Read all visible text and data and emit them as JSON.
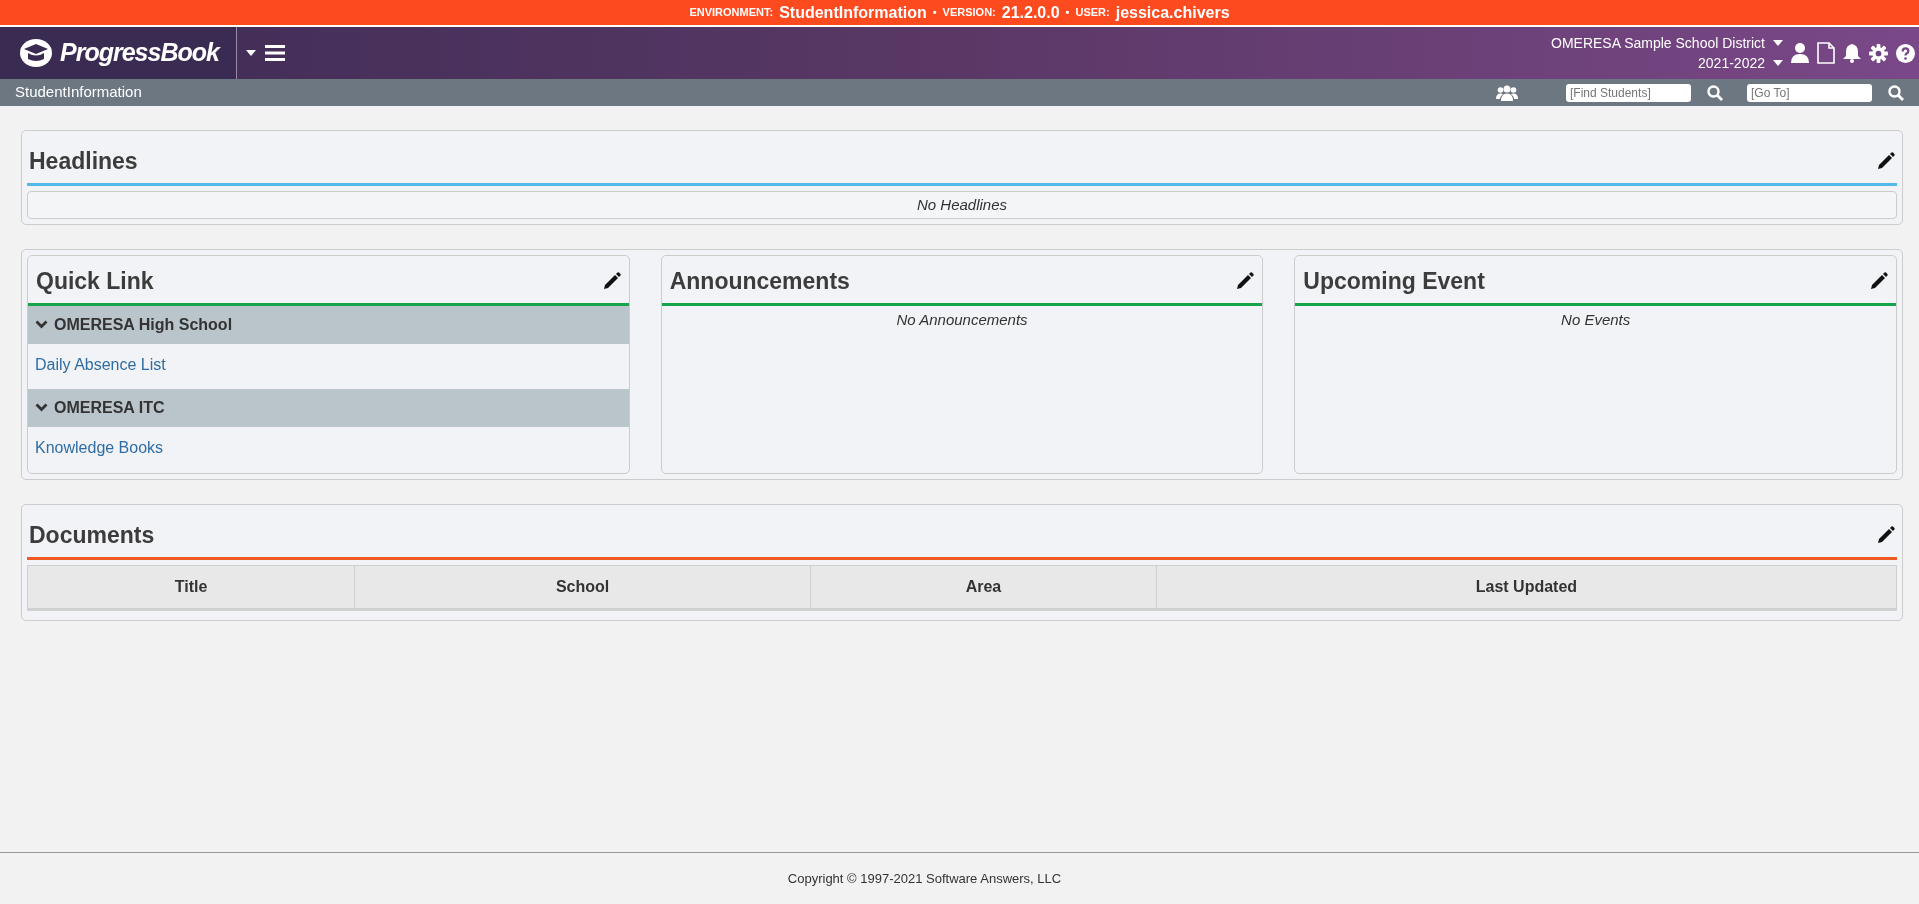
{
  "env_bar": {
    "separator": "•",
    "items": [
      {
        "label": "ENVIRONMENT:",
        "value": "StudentInformation"
      },
      {
        "label": "VERSION:",
        "value": "21.2.0.0"
      },
      {
        "label": "USER:",
        "value": "jessica.chivers"
      }
    ]
  },
  "header": {
    "logo_text": "ProgressBook",
    "district": "OMERESA Sample School District",
    "school_year": "2021-2022"
  },
  "sub_bar": {
    "title": "StudentInformation",
    "find_students": {
      "placeholder": "[Find Students]"
    },
    "go_to": {
      "placeholder": "[Go To]"
    }
  },
  "headlines": {
    "title": "Headlines",
    "empty_text": "No Headlines"
  },
  "quick_link": {
    "title": "Quick Link",
    "groups": [
      {
        "name": "OMERESA High School",
        "expanded": true,
        "links": [
          "Daily Absence List"
        ]
      },
      {
        "name": "OMERESA ITC",
        "expanded": true,
        "links": [
          "Knowledge Books"
        ]
      }
    ]
  },
  "announcements": {
    "title": "Announcements",
    "empty_text": "No Announcements"
  },
  "upcoming_event": {
    "title": "Upcoming Event",
    "empty_text": "No Events"
  },
  "documents": {
    "title": "Documents",
    "columns": [
      "Title",
      "School",
      "Area",
      "Last Updated"
    ]
  },
  "footer": {
    "copyright": "Copyright © 1997-2021 Software Answers, LLC"
  }
}
